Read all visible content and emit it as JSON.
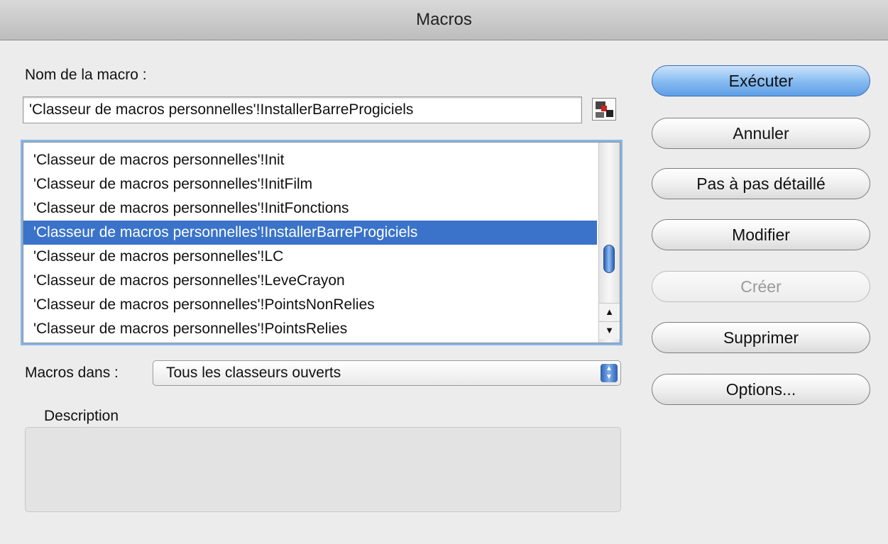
{
  "window": {
    "title": "Macros"
  },
  "macro_name": {
    "label": "Nom de la macro :",
    "value": "'Classeur de macros personnelles'!InstallerBarreProgiciels"
  },
  "macro_list": {
    "items": [
      "'Classeur de macros personnelles'!Init",
      "'Classeur de macros personnelles'!InitFilm",
      "'Classeur de macros personnelles'!InitFonctions",
      "'Classeur de macros personnelles'!InstallerBarreProgiciels",
      "'Classeur de macros personnelles'!LC",
      "'Classeur de macros personnelles'!LeveCrayon",
      "'Classeur de macros personnelles'!PointsNonRelies",
      "'Classeur de macros personnelles'!PointsRelies"
    ],
    "selected_index": 3
  },
  "macros_in": {
    "label": "Macros dans :",
    "value": "Tous les classeurs ouverts"
  },
  "description": {
    "label": "Description",
    "value": ""
  },
  "buttons": {
    "run": "Exécuter",
    "cancel": "Annuler",
    "step_into": "Pas à pas détaillé",
    "edit": "Modifier",
    "create": "Créer",
    "delete": "Supprimer",
    "options": "Options..."
  },
  "colors": {
    "selection": "#3a73c9",
    "default_button": "#89bdf1"
  }
}
